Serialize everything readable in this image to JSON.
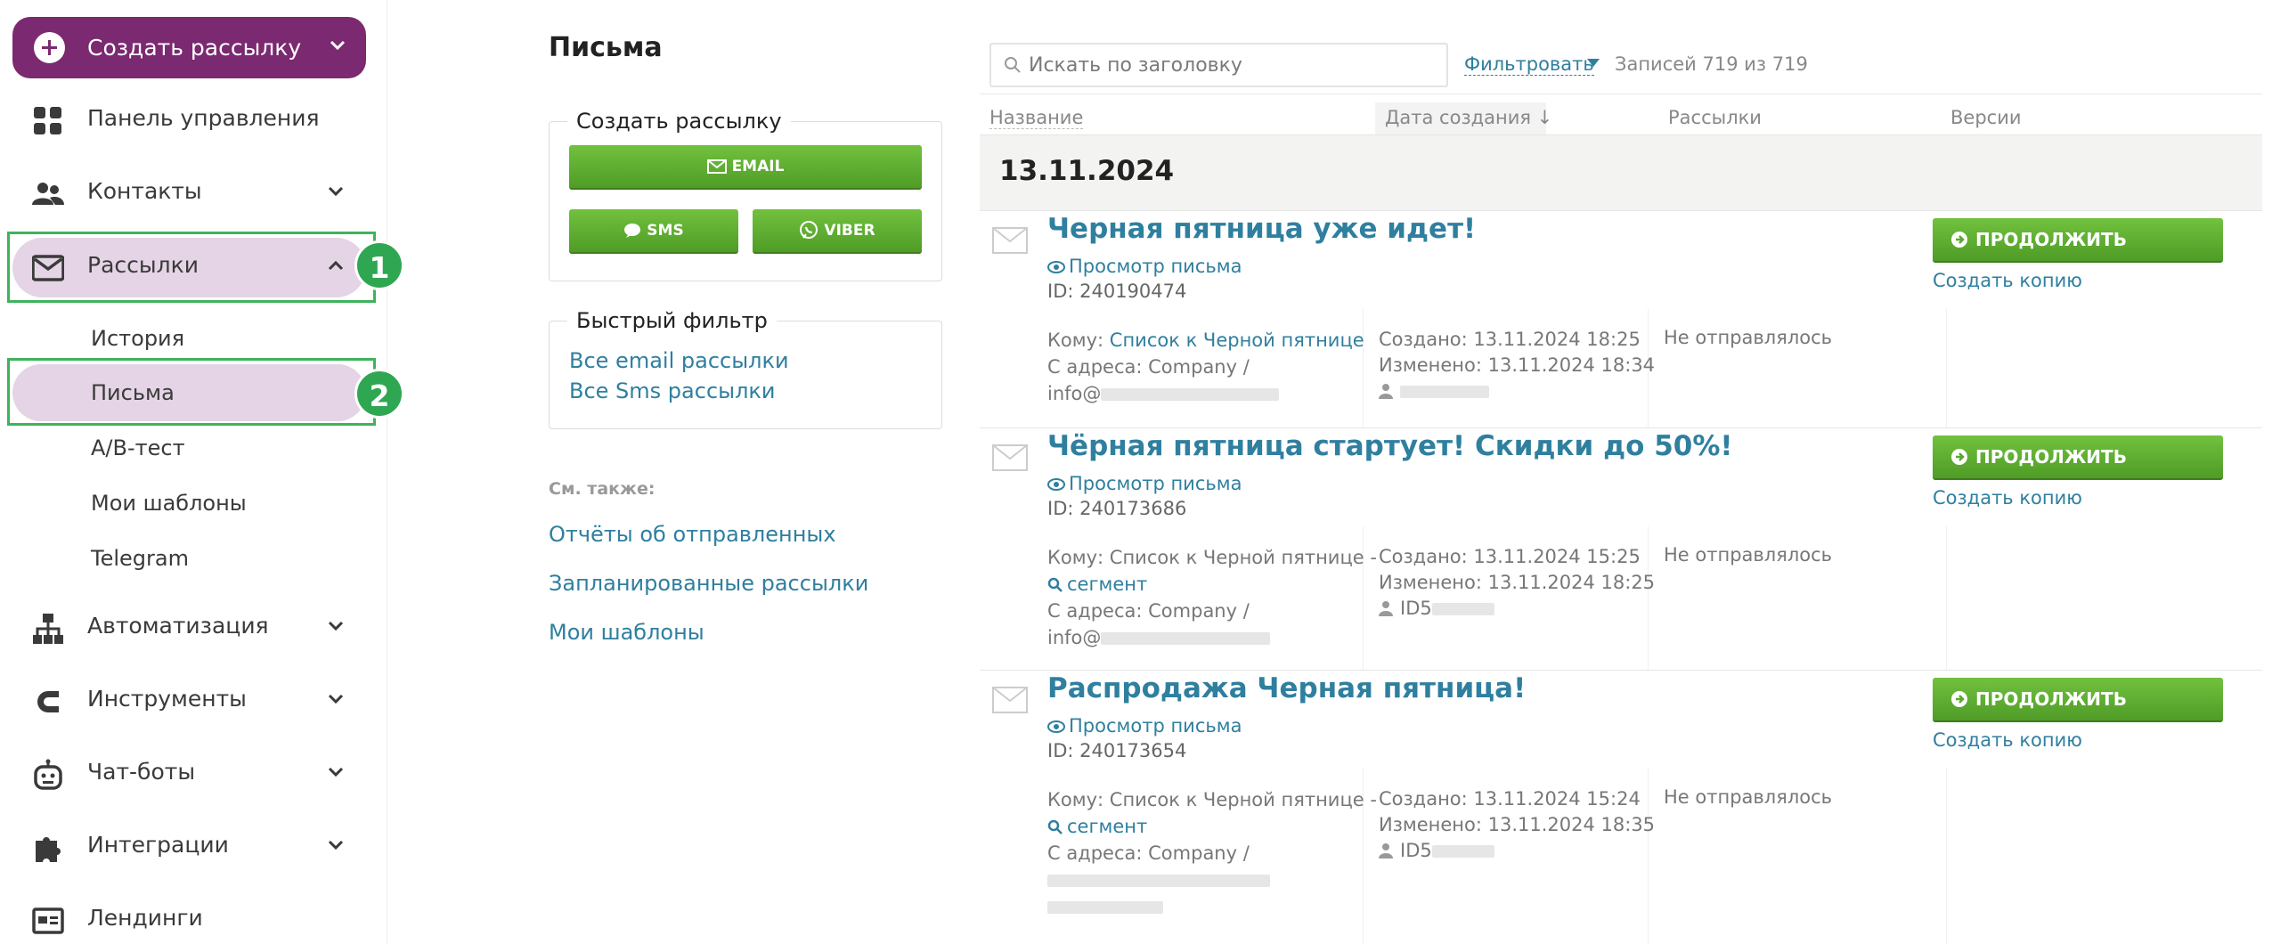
{
  "sidebar": {
    "create_label": "Создать рассылку",
    "items": [
      {
        "label": "Панель управления"
      },
      {
        "label": "Контакты"
      },
      {
        "label": "Рассылки"
      },
      {
        "label": "Автоматизация"
      },
      {
        "label": "Инструменты"
      },
      {
        "label": "Чат-боты"
      },
      {
        "label": "Интеграции"
      },
      {
        "label": "Лендинги"
      }
    ],
    "sub_items": [
      {
        "label": "История"
      },
      {
        "label": "Письма"
      },
      {
        "label": "A/B-тест"
      },
      {
        "label": "Мои шаблоны"
      },
      {
        "label": "Telegram"
      }
    ],
    "badges": [
      "1",
      "2"
    ],
    "accent": "#7b2970",
    "active_bg": "#e4d4e5"
  },
  "main": {
    "title": "Письма",
    "create_panel": {
      "legend": "Создать рассылку",
      "email_label": "EMAIL",
      "sms_label": "SMS",
      "viber_label": "VIBER"
    },
    "quick_filter": {
      "legend": "Быстрый фильтр",
      "links": [
        "Все email рассылки",
        "Все Sms рассылки"
      ]
    },
    "see_also": {
      "label": "См. также:",
      "links": [
        "Отчёты об отправленных",
        "Запланированные рассылки",
        "Мои шаблоны"
      ]
    }
  },
  "table": {
    "search_placeholder": "Искать по заголовку",
    "filter_label": "Фильтровать",
    "records_label": "Записей 719 из 719",
    "columns": [
      "Название",
      "Дата создания ↓",
      "Рассылки",
      "Версии"
    ],
    "date_group": "13.11.2024",
    "rows": [
      {
        "title": "Черная пятница уже идет!",
        "view_label": "Просмотр письма",
        "id": "ID: 240190474",
        "to_prefix": "Кому: ",
        "to_link": "Список к Черной пятнице",
        "to_suffix": "",
        "from_line1": "С адреса: Company /",
        "from_line2": "info@",
        "created": "Создано: 13.11.2024 18:25",
        "modified": "Изменено: 13.11.2024 18:34",
        "author": "",
        "status": "Не отправлялось",
        "continue_label": "ПРОДОЛЖИТЬ",
        "copy_label": "Создать копию"
      },
      {
        "title": "Чёрная пятница стартует! Скидки до 50%!",
        "view_label": "Просмотр письма",
        "id": "ID: 240173686",
        "to_prefix": "Кому: Список к Черной пятнице -",
        "to_link": "сегмент",
        "to_suffix": "",
        "from_line1": "С адреса: Company /",
        "from_line2": "info@",
        "created": "Создано: 13.11.2024 15:25",
        "modified": "Изменено: 13.11.2024 18:25",
        "author": "ID5",
        "status": "Не отправлялось",
        "continue_label": "ПРОДОЛЖИТЬ",
        "copy_label": "Создать копию"
      },
      {
        "title": "Распродажа Черная пятница!",
        "view_label": "Просмотр письма",
        "id": "ID: 240173654",
        "to_prefix": "Кому: Список к Черной пятнице -",
        "to_link": "сегмент",
        "to_suffix": "",
        "from_line1": "С адреса: Company /",
        "from_line2": "",
        "created": "Создано: 13.11.2024 15:24",
        "modified": "Изменено: 13.11.2024 18:35",
        "author": "ID5",
        "status": "Не отправлялось",
        "continue_label": "ПРОДОЛЖИТЬ",
        "copy_label": "Создать копию"
      }
    ],
    "link_color": "#2f7f9f",
    "button_color": "#5aa82e"
  }
}
